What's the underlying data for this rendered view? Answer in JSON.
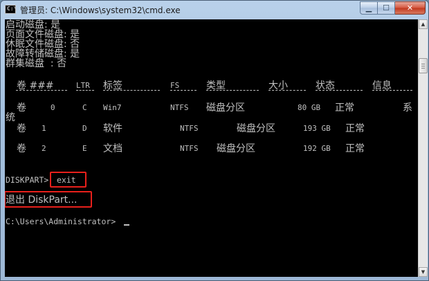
{
  "window": {
    "title": "管理员: C:\\Windows\\system32\\cmd.exe",
    "icon_text": "C:\\"
  },
  "controls": {
    "minimize": "▁",
    "maximize": "☐",
    "close": "✕"
  },
  "console": {
    "status_lines": [
      "启动磁盘: 是",
      "页面文件磁盘: 是",
      "休眠文件磁盘: 否",
      "故障转储磁盘: 是",
      "群集磁盘  : 否"
    ],
    "table": {
      "headers": [
        "卷 ###",
        "LTR",
        "标签",
        "FS",
        "类型",
        "大小",
        "状态",
        "信息"
      ],
      "rows": [
        [
          "卷",
          "0",
          "C",
          "Win7",
          "NTFS",
          "磁盘分区",
          "80 GB",
          "正常",
          "系"
        ],
        [
          "卷",
          "1",
          "D",
          "软件",
          "NTFS",
          "磁盘分区",
          "193 GB",
          "正常",
          ""
        ],
        [
          "卷",
          "2",
          "E",
          "文档",
          "NTFS",
          "磁盘分区",
          "192 GB",
          "正常",
          ""
        ]
      ],
      "wrap_text": "统"
    },
    "prompt_prefix": "DISKPART>",
    "command": "exit",
    "exit_message": "退出 DiskPart...",
    "final_prompt": "C:\\Users\\Administrator>"
  },
  "colors": {
    "highlight": "#e8201b",
    "console_text": "#c0c0c0",
    "console_bg": "#000000"
  },
  "scrollbar": {
    "up_arrow": "▲",
    "down_arrow": "▼"
  }
}
